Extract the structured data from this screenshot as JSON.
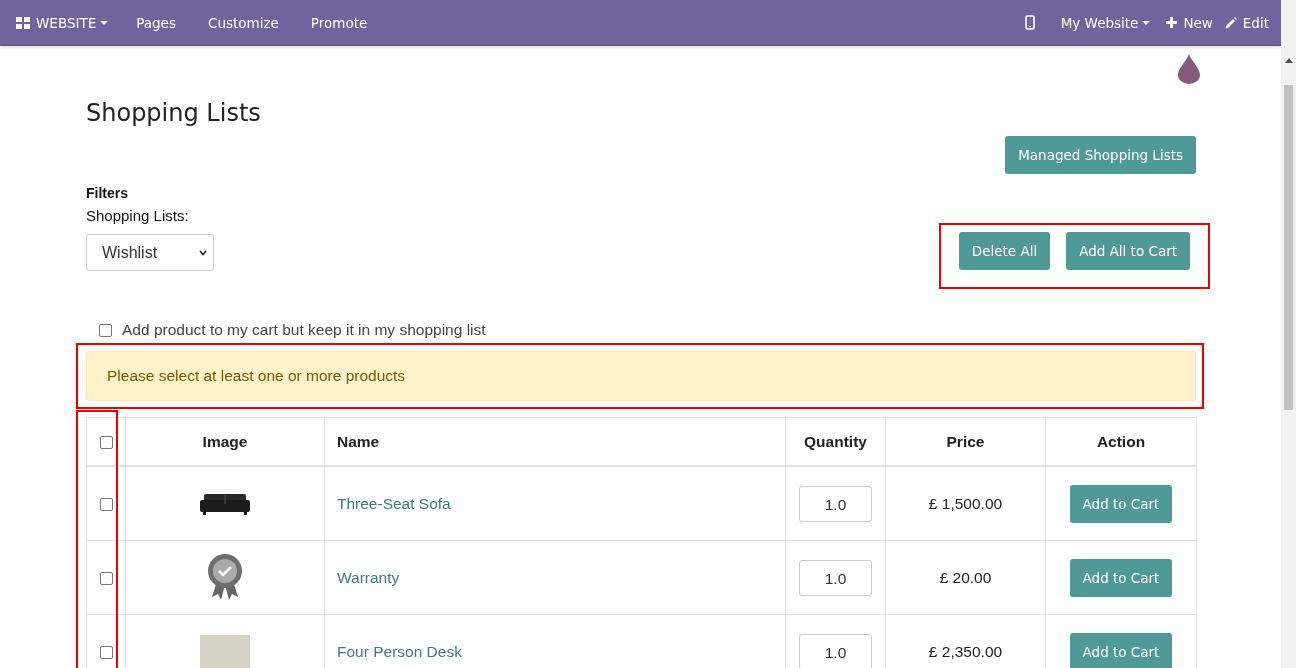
{
  "topbar": {
    "app_menu": "WEBSITE",
    "menu": [
      "Pages",
      "Customize",
      "Promote"
    ],
    "site_menu": "My Website",
    "new_button": "New",
    "edit_button": "Edit"
  },
  "page": {
    "title": "Shopping Lists",
    "manage_button": "Managed Shopping Lists",
    "filters_heading": "Filters",
    "list_label": "Shopping Lists:",
    "list_select": "Wishlist",
    "bulk_buttons": [
      "Delete All",
      "Add All to Cart"
    ],
    "keep_option": {
      "label": "Add product to my cart but keep it in my shopping list",
      "checked": false
    },
    "alert": "Please select at least one or more products"
  },
  "table": {
    "select_all_checked": false,
    "columns": [
      "Image",
      "Name",
      "Quantity",
      "Price",
      "Action"
    ],
    "rows": [
      {
        "checked": false,
        "image": {
          "kind": "sofa"
        },
        "name": "Three-Seat Sofa",
        "quantity": "1.0",
        "price": "£ 1,500.00",
        "action": "Add to Cart"
      },
      {
        "checked": false,
        "image": {
          "kind": "badge"
        },
        "name": "Warranty",
        "quantity": "1.0",
        "price": "£ 20.00",
        "action": "Add to Cart"
      },
      {
        "checked": false,
        "image": {
          "kind": "photo"
        },
        "name": "Four Person Desk",
        "quantity": "1.0",
        "price": "£ 2,350.00",
        "action": "Add to Cart"
      }
    ]
  }
}
